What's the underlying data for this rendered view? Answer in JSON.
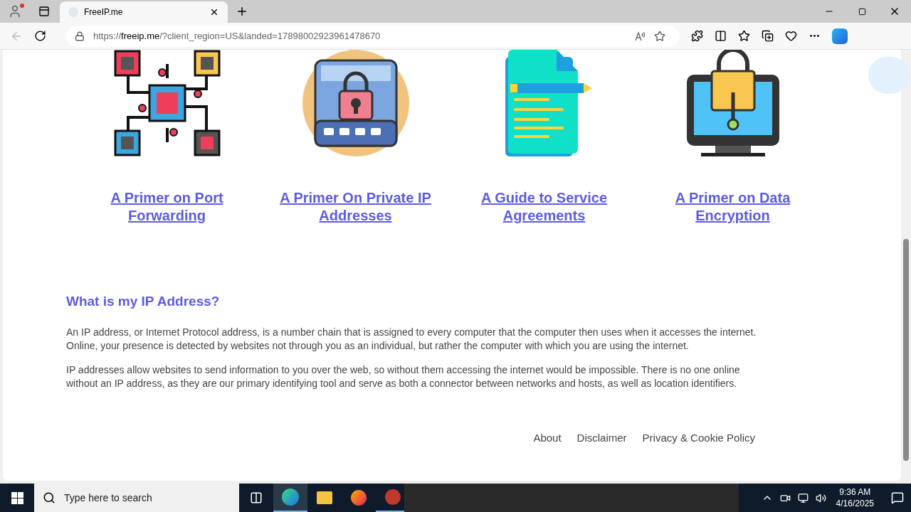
{
  "browser": {
    "tab": {
      "title": "FreeIP.me"
    },
    "address": {
      "prefix": "https://",
      "domain": "freeip.me",
      "rest": "/?client_region=US&landed=17898002923961478670"
    }
  },
  "cards": [
    {
      "kind": "network",
      "title": "A Primer on Port Forwarding"
    },
    {
      "kind": "lock",
      "title": "A Primer On Private IP Addresses"
    },
    {
      "kind": "document",
      "title": "A Guide to Service Agreements"
    },
    {
      "kind": "laptop",
      "title": "A Primer on Data Encryption"
    }
  ],
  "section": {
    "heading": "What is my IP Address?",
    "paragraphs": [
      "An IP address, or Internet Protocol address, is a number chain that is assigned to every computer that the computer then uses when it accesses the internet. Online, your presence is detected by websites not through you as an individual, but rather the computer with which you are using the internet.",
      "IP addresses allow websites to send information to you over the web, so without them accessing the internet would be impossible. There is no one online without an IP address, as they are our primary identifying tool and serve as both a connector between networks and hosts, as well as location identifiers."
    ]
  },
  "footer_links": [
    "About",
    "Disclaimer",
    "Privacy & Cookie Policy"
  ],
  "taskbar": {
    "search_placeholder": "Type here to search",
    "time": "9:36 AM",
    "date": "4/16/2025"
  }
}
